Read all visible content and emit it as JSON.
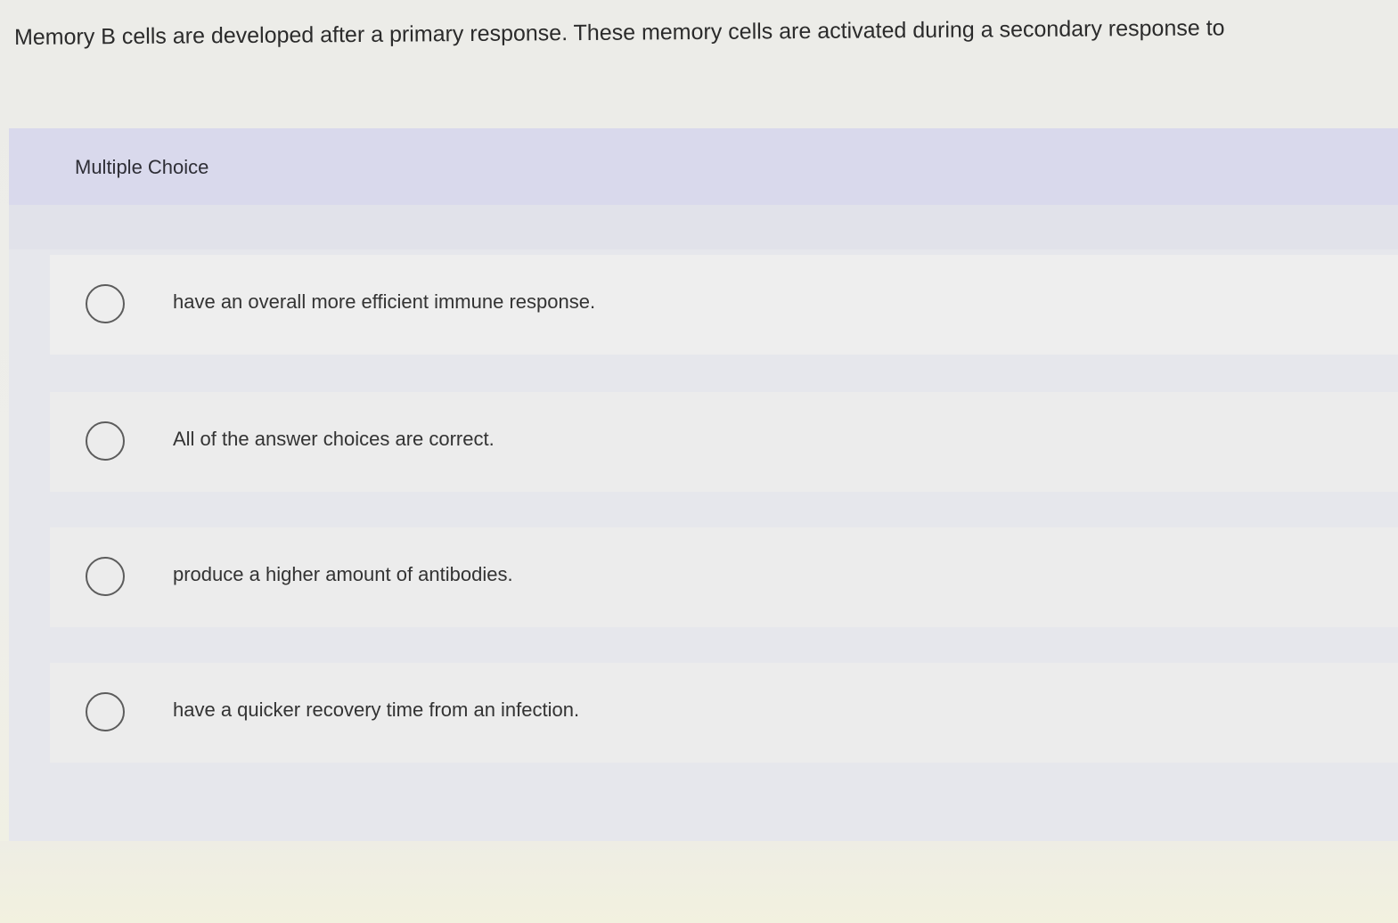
{
  "question": {
    "text": "Memory B cells are developed after a primary response. These memory cells are activated during a secondary response to"
  },
  "multiple_choice": {
    "header_label": "Multiple Choice",
    "options": [
      {
        "label": "have an overall more efficient immune response."
      },
      {
        "label": "All of the answer choices are correct."
      },
      {
        "label": "produce a higher amount of antibodies."
      },
      {
        "label": "have a quicker recovery time from an infection."
      }
    ]
  }
}
